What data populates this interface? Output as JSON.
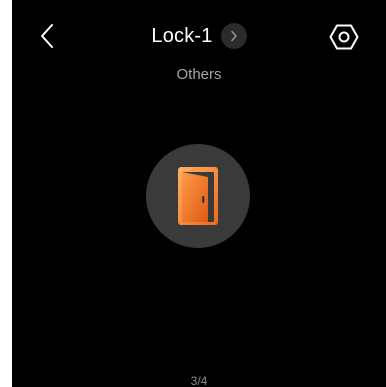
{
  "header": {
    "title": "Lock-1",
    "back_icon": "chevron-left-icon",
    "next_icon": "chevron-right-icon",
    "settings_icon": "hexagon-settings-icon"
  },
  "category": {
    "label": "Others"
  },
  "device": {
    "icon": "door-icon",
    "icon_gradient": [
      "#ffa25a",
      "#f07020"
    ]
  },
  "pager": {
    "text": "3/4"
  },
  "colors": {
    "background": "#000000",
    "circle": "#3a3a3a",
    "accent": "#f58a3a"
  }
}
